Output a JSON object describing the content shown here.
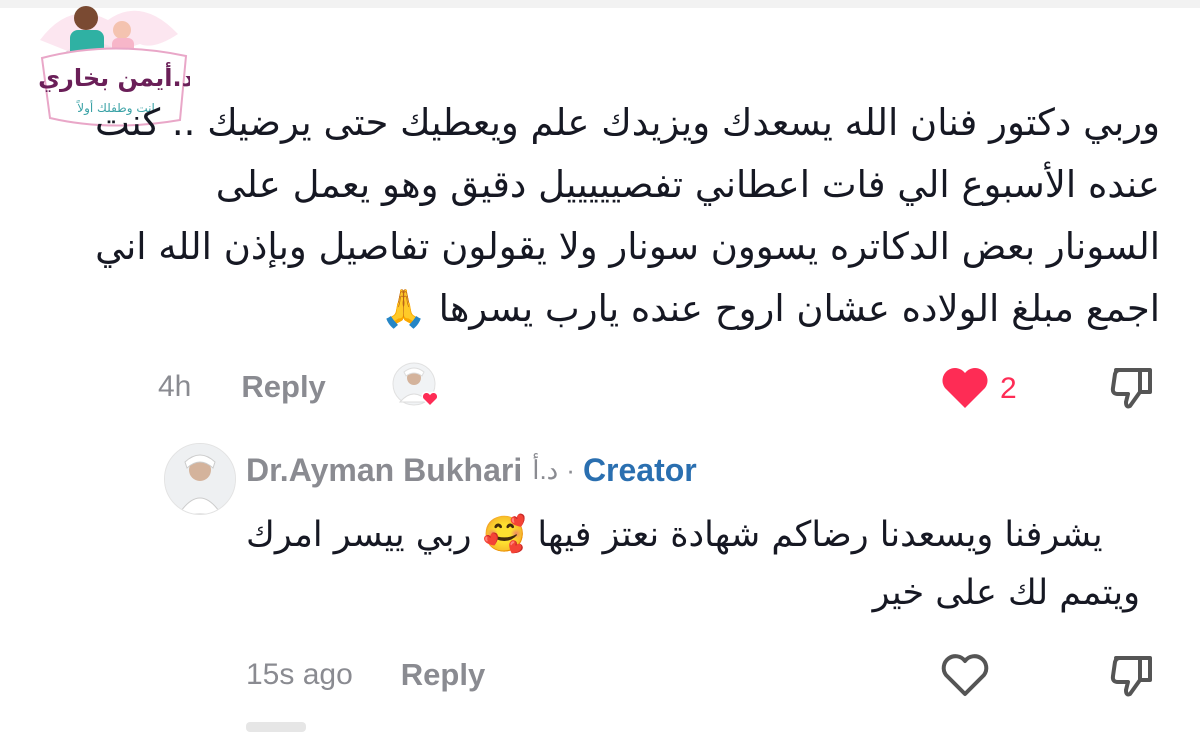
{
  "logo": {
    "name_text": "د.أيمن بخاري",
    "tagline_text": "انت وطفلك أولاً"
  },
  "comment": {
    "lines": [
      "وربي دكتور فنان الله يسعدك ويزيدك علم ويعطيك حتى يرضيك .. كنت",
      "عنده الأسبوع الي فات اعطاني تفصيييييل دقيق وهو يعمل على",
      "السونار بعض الدكاتره يسوون سونار ولا يقولون تفاصيل وبإذن الله اني",
      "اجمع مبلغ الولاده عشان اروح عنده يارب يسرها 🙏"
    ],
    "time": "4h",
    "reply_label": "Reply",
    "like_count": "2",
    "liked_by_creator_icon": "heart-badge-icon"
  },
  "reply": {
    "author": "Dr.Ayman Bukhari",
    "author_alt": "د.أ",
    "separator": "·",
    "badge": "Creator",
    "lines": [
      "يشرفنا ويسعدنا رضاكم شهادة نعتز فيها 🥰 ربي ييسر امرك",
      "ويتمم لك على خير"
    ],
    "time": "15s ago",
    "reply_label": "Reply"
  },
  "colors": {
    "accent_red": "#fe2c55",
    "creator_blue": "#2a6fb0",
    "muted": "#8a8b91"
  }
}
